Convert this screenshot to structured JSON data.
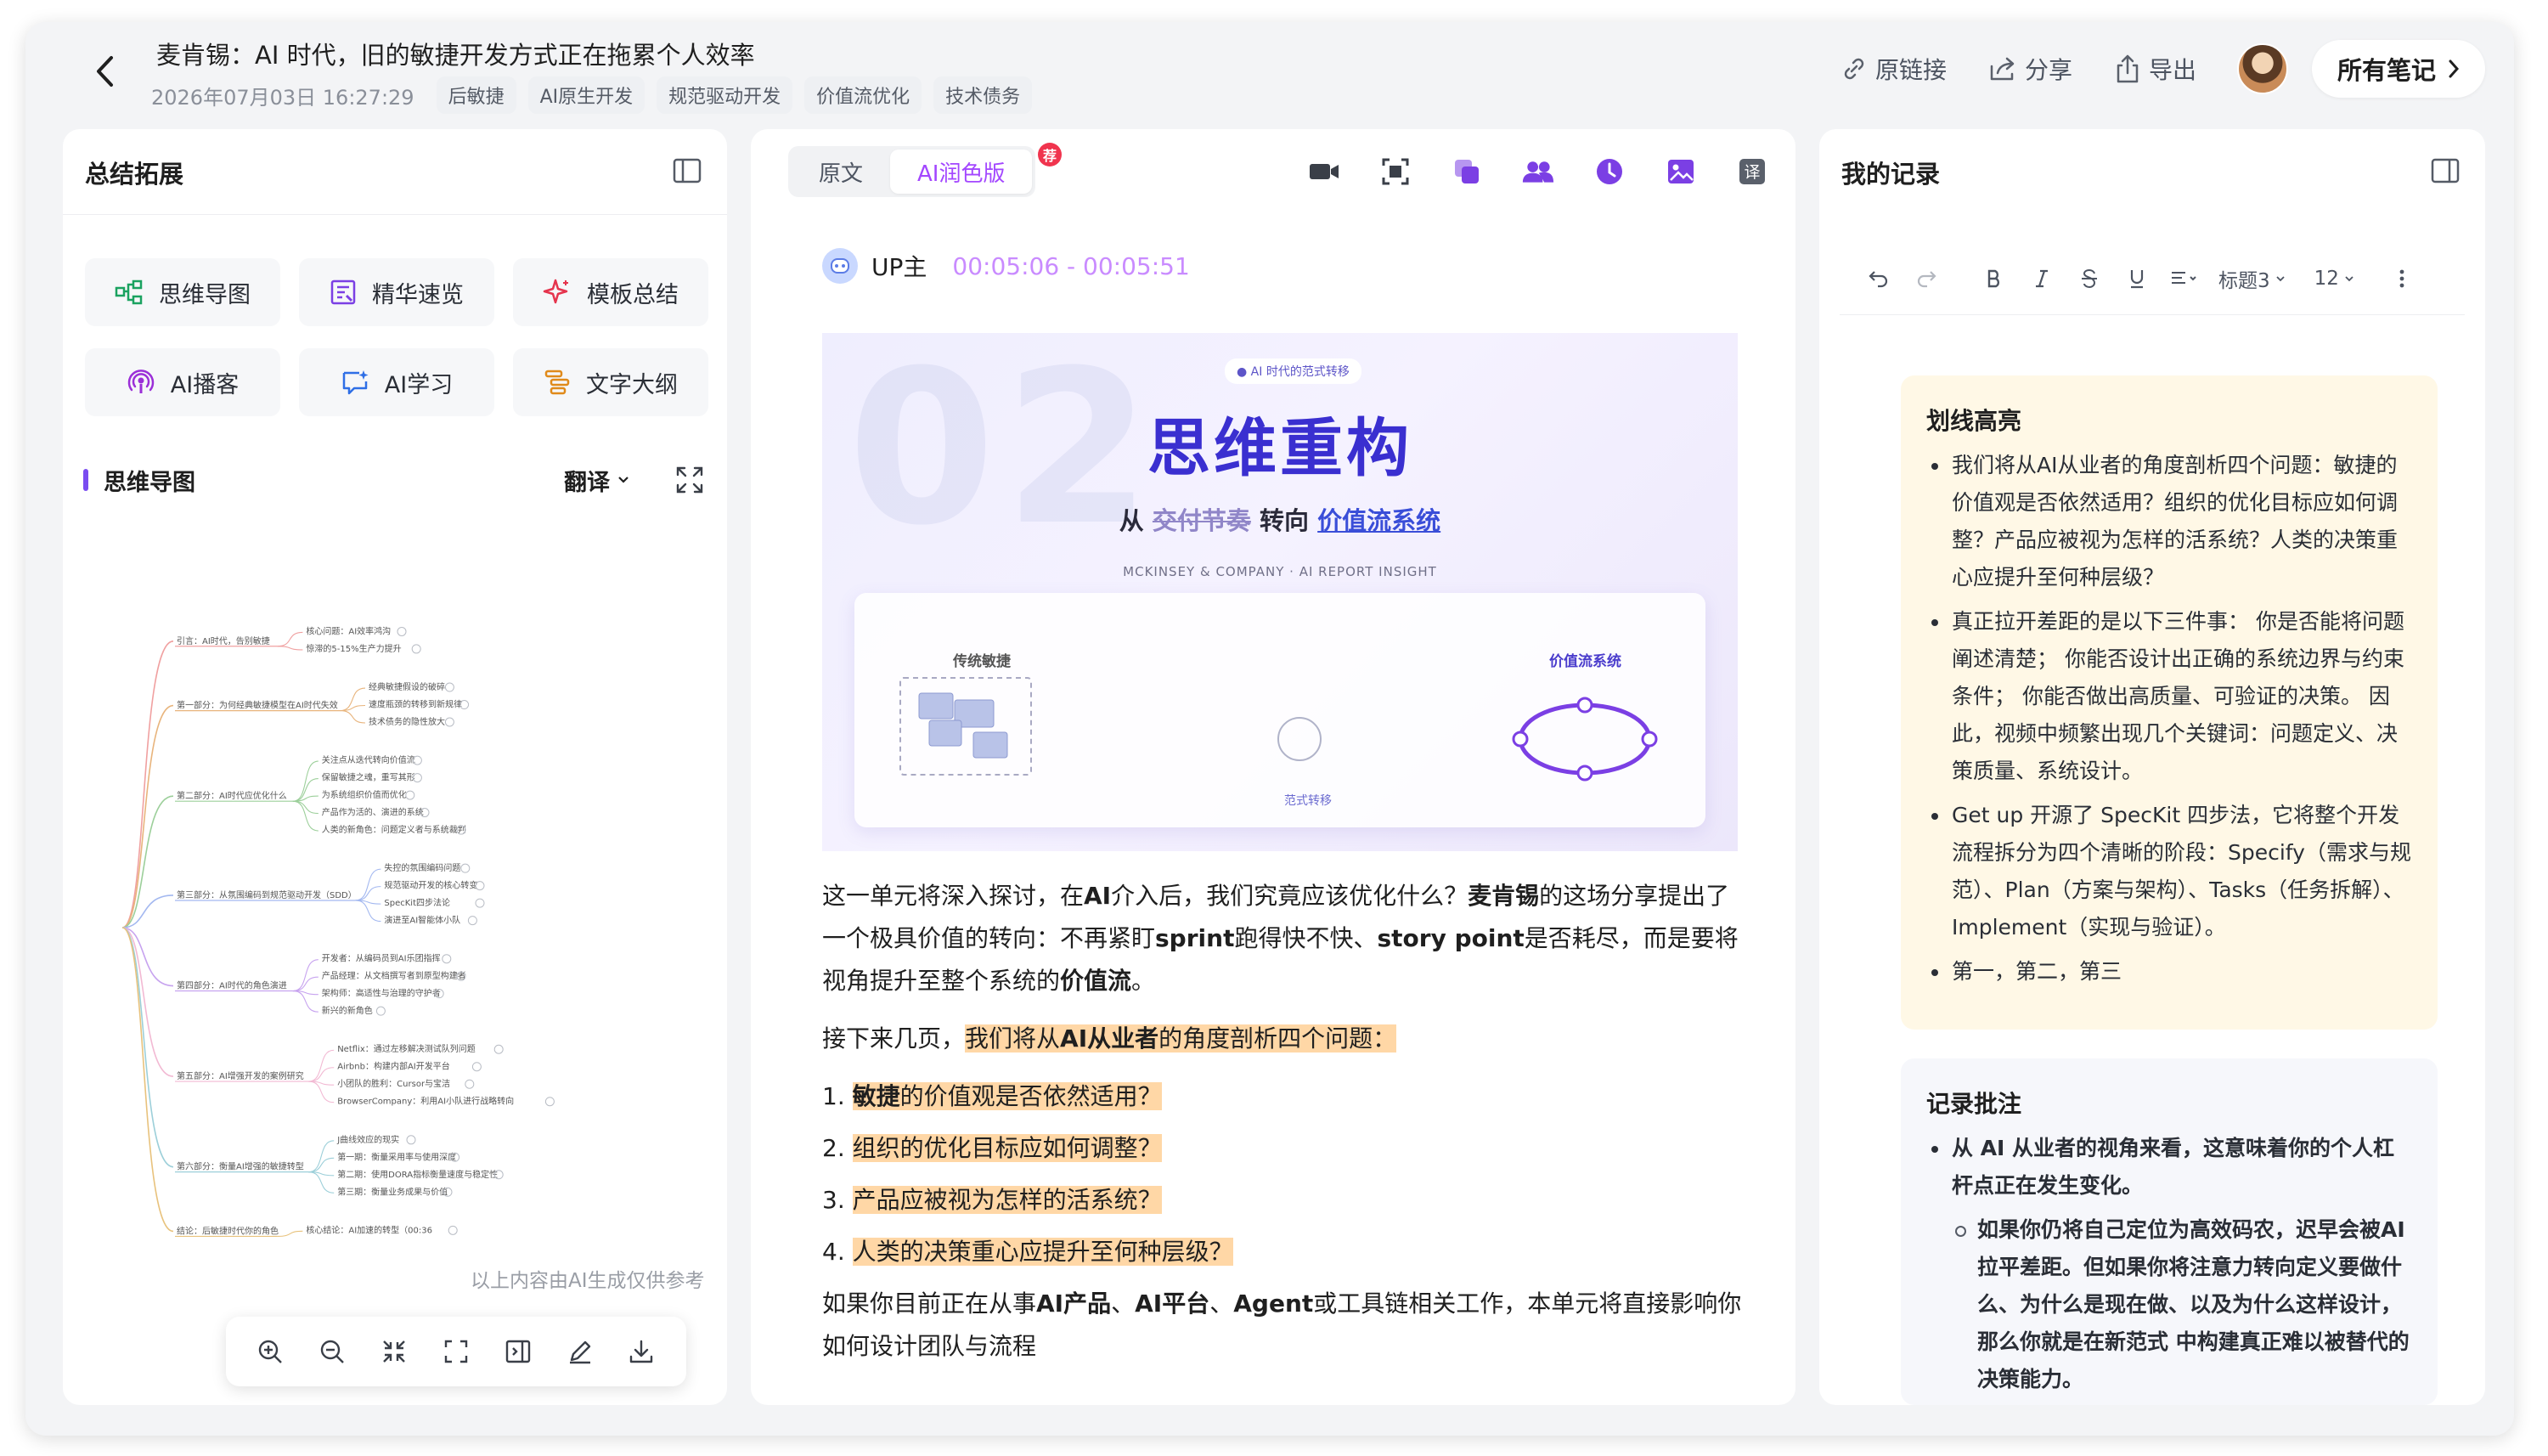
{
  "header": {
    "title": "麦肯锡：AI 时代，旧的敏捷开发方式正在拖累个人效率",
    "date": "2026年07月03日 16:27:29",
    "tags": [
      "后敏捷",
      "AI原生开发",
      "规范驱动开发",
      "价值流优化",
      "技术债务"
    ],
    "actions": {
      "source": "原链接",
      "share": "分享",
      "export": "导出"
    },
    "all_notes": "所有笔记"
  },
  "left": {
    "title": "总结拓展",
    "tools": [
      {
        "label": "思维导图",
        "icon": "mindmap-icon",
        "color": "#1aa260"
      },
      {
        "label": "精华速览",
        "icon": "list-highlight-icon",
        "color": "#7b3fe4"
      },
      {
        "label": "模板总结",
        "icon": "sparkle-icon",
        "color": "#e5344d"
      },
      {
        "label": "AI播客",
        "icon": "podcast-icon",
        "color": "#9b2fd8"
      },
      {
        "label": "AI学习",
        "icon": "chat-learn-icon",
        "color": "#2f6fe6"
      },
      {
        "label": "文字大纲",
        "icon": "outline-icon",
        "color": "#e08a1a"
      }
    ],
    "mindmap_title": "思维导图",
    "translate": "翻译",
    "mindmap": {
      "root": "",
      "branches": [
        {
          "label": "引言：AI时代，告别敏捷",
          "children": [
            "核心问题：AI效率鸿沟",
            "惊滞的5-15%生产力提升"
          ]
        },
        {
          "label": "第一部分：为何经典敏捷模型在AI时代失效",
          "children": [
            "经典敏捷假设的破碎",
            "速度瓶颈的转移到新规律",
            "技术债务的隐性放大"
          ]
        },
        {
          "label": "第二部分：AI时代应优化什么",
          "children": [
            "关注点从迭代转向价值流",
            "保留敏捷之魂，重写其形",
            "为系统组织价值而优化",
            "产品作为活的、演进的系统",
            "人类的新角色：问题定义者与系统裁判"
          ]
        },
        {
          "label": "第三部分：从氛围编码到规范驱动开发（SDD）",
          "children": [
            "失控的氛围编码问题",
            "规范驱动开发的核心转变",
            "SpecKit四步法论",
            "演进至AI智能体小队"
          ]
        },
        {
          "label": "第四部分：AI时代的角色演进",
          "children": [
            "开发者：从编码员到AI乐团指挥",
            "产品经理：从文档撰写者到原型构建者",
            "架构师：高适性与治理的守护者",
            "新兴的新角色"
          ]
        },
        {
          "label": "第五部分：AI增强开发的案例研究",
          "children": [
            "Netflix：通过左移解决测试队列问题",
            "Airbnb：构建内部AI开发平台",
            "小团队的胜利：Cursor与宝洁",
            "BrowserCompany：利用AI小队进行战略转向"
          ]
        },
        {
          "label": "第六部分：衡量AI增强的敏捷转型",
          "children": [
            "J曲线效应的现实",
            "第一期：衡量采用率与使用深度",
            "第二期：使用DORA指标衡量速度与稳定性",
            "第三期：衡量业务成果与价值"
          ]
        },
        {
          "label": "结论：后敏捷时代你的角色",
          "children": [
            "核心结论：AI加速的转型（00:36"
          ]
        }
      ]
    },
    "disclaimer": "以上内容由AI生成仅供参考"
  },
  "middle": {
    "tabs": [
      "原文",
      "AI润色版"
    ],
    "active_tab": "AI润色版",
    "badge": "荐",
    "speaker": "UP主",
    "time_range": "00:05:06 - 00:05:51",
    "slide": {
      "tag": "● AI 时代的范式转移",
      "watermark": "02",
      "title": "思维重构",
      "subtitle_prefix": "从",
      "subtitle_struck": "交付节奏",
      "subtitle_mid": "转向",
      "subtitle_blue": "价值流系统",
      "source": "MCKINSEY & COMPANY · AI REPORT INSIGHT",
      "left_label": "传统敏捷",
      "right_label": "价值流系统",
      "center_label": "范式转移"
    },
    "article": {
      "p1": [
        {
          "t": "这一单元将深入探讨，在",
          "b": false
        },
        {
          "t": "AI",
          "b": true
        },
        {
          "t": "介入后，我们究竟应该优化什么？",
          "b": false
        },
        {
          "t": "麦肯锡",
          "b": true
        },
        {
          "t": "的这场分享提出了一个极具价值的转向：不再紧盯",
          "b": false
        },
        {
          "t": "sprint",
          "b": true
        },
        {
          "t": "跑得快不快、",
          "b": false
        },
        {
          "t": "story point",
          "b": true
        },
        {
          "t": "是否耗尽，而是要将视角提升至整个系统的",
          "b": false
        },
        {
          "t": "价值流",
          "b": true
        },
        {
          "t": "。",
          "b": false
        }
      ],
      "p2_prefix": "接下来几页，",
      "p2_hl": [
        {
          "t": "我们将从",
          "b": false
        },
        {
          "t": "AI从业者",
          "b": true
        },
        {
          "t": "的角度剖析四个问题：",
          "b": false
        }
      ],
      "questions": [
        [
          {
            "t": "敏捷",
            "b": true
          },
          {
            "t": "的价值观是否依然适用？",
            "b": false
          }
        ],
        [
          {
            "t": "组织的优化目标应如何调整？",
            "b": false
          }
        ],
        [
          {
            "t": "产品应被视为怎样的活系统？",
            "b": false
          }
        ],
        [
          {
            "t": "人类的决策重心应提升至何种层级？",
            "b": false
          }
        ]
      ],
      "p3": [
        {
          "t": "如果你目前正在从事",
          "b": false
        },
        {
          "t": "AI产品",
          "b": true
        },
        {
          "t": "、",
          "b": false
        },
        {
          "t": "AI平台",
          "b": true
        },
        {
          "t": "、",
          "b": false
        },
        {
          "t": "Agent",
          "b": true
        },
        {
          "t": "或工具链相关工作，本单元将直接影响你如何设计团队与流程",
          "b": false
        }
      ]
    }
  },
  "right": {
    "title": "我的记录",
    "toolbar": {
      "heading": "标题3",
      "size": "12"
    },
    "highlight_card": {
      "title": "划线高亮",
      "items": [
        "我们将从AI从业者的角度剖析四个问题：敏捷的价值观是否依然适用？组织的优化目标应如何调整？产品应被视为怎样的活系统？人类的决策重心应提升至何种层级？",
        "真正拉开差距的是以下三件事： 你是否能将问题阐述清楚； 你能否设计出正确的系统边界与约束条件； 你能否做出高质量、可验证的决策。 因此，视频中频繁出现几个关键词：问题定义、决策质量、系统设计。",
        "Get up 开源了 SpecKit 四步法，它将整个开发流程拆分为四个清晰的阶段：Specify（需求与规范）、Plan（方案与架构）、Tasks（任务拆解）、Implement（实现与验证）。",
        "第一，第二，第三"
      ]
    },
    "note_card": {
      "title": "记录批注",
      "item": "从 AI 从业者的视角来看，这意味着你的个人杠杆点正在发生变化。",
      "sub_item": "如果你仍将自己定位为高效码农，迟早会被AI拉平差距。但如果你将注意力转向定义要做什么、为什么是现在做、以及为什么这样设计，那么你就是在新范式 中构建真正难以被替代的决策能力。"
    }
  }
}
